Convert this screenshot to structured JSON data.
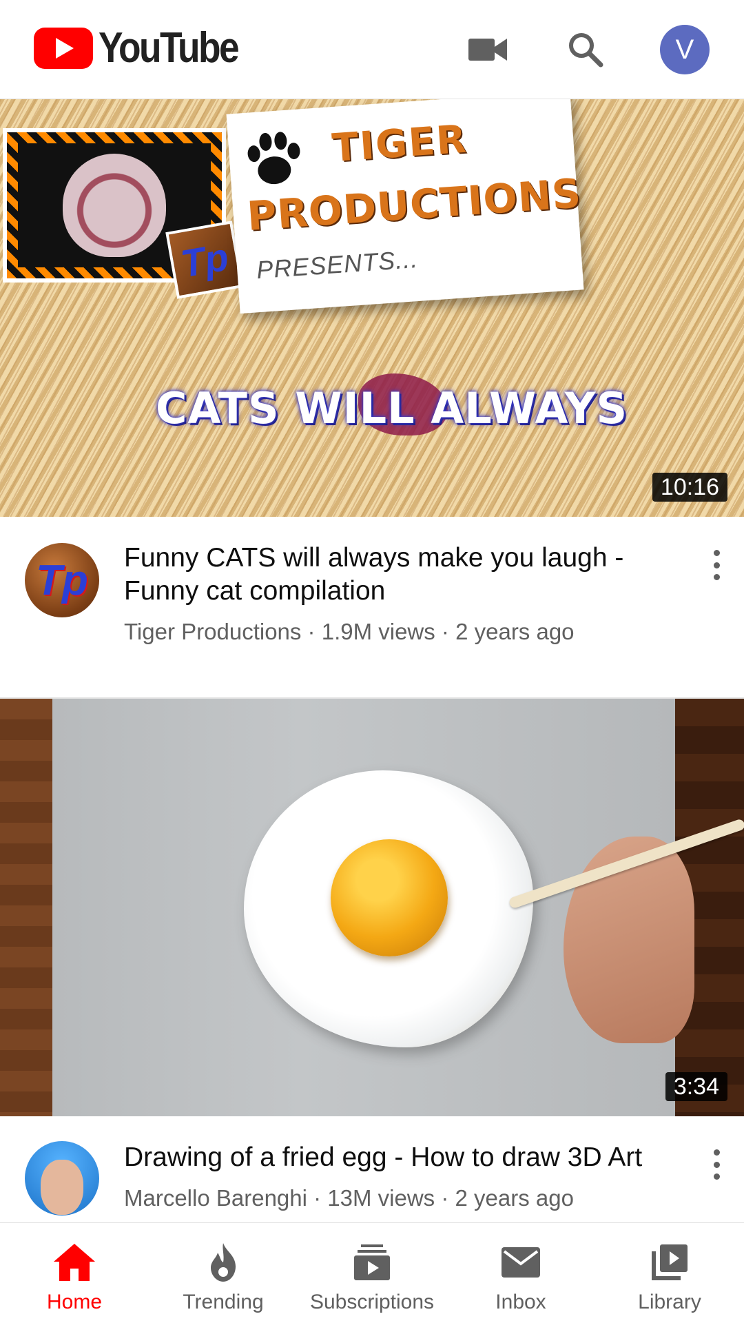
{
  "app": {
    "logo_text": "YouTube",
    "avatar_letter": "V",
    "colors": {
      "brand": "#ff0000",
      "avatar": "#5c6bc0",
      "meta_text": "#606060"
    }
  },
  "topbar": {
    "icons": [
      "youtube-logo-icon",
      "video-camera-icon",
      "search-icon",
      "account-avatar"
    ]
  },
  "videos": [
    {
      "title": "Funny CATS will always make you laugh - Funny cat compilation",
      "channel": "Tiger Productions",
      "views": "1.9M views",
      "age": "2 years ago",
      "meta": "Tiger Productions · 1.9M views · 2 years ago",
      "duration": "10:16",
      "thumbnail_text": {
        "line1": "TIGER",
        "line2": "PRODUCTIONS",
        "line3": "PRESENTS...",
        "line4": "CATS WILL ALWAYS"
      }
    },
    {
      "title": "Drawing of a fried egg - How to draw 3D Art",
      "channel": "Marcello Barenghi",
      "views": "13M views",
      "age": "2 years ago",
      "meta": "Marcello Barenghi · 13M views · 2 years ago",
      "duration": "3:34"
    }
  ],
  "bottom_nav": {
    "items": [
      {
        "label": "Home",
        "icon": "home-icon",
        "active": true
      },
      {
        "label": "Trending",
        "icon": "flame-icon",
        "active": false
      },
      {
        "label": "Subscriptions",
        "icon": "subscriptions-icon",
        "active": false
      },
      {
        "label": "Inbox",
        "icon": "mail-icon",
        "active": false
      },
      {
        "label": "Library",
        "icon": "library-icon",
        "active": false
      }
    ]
  }
}
